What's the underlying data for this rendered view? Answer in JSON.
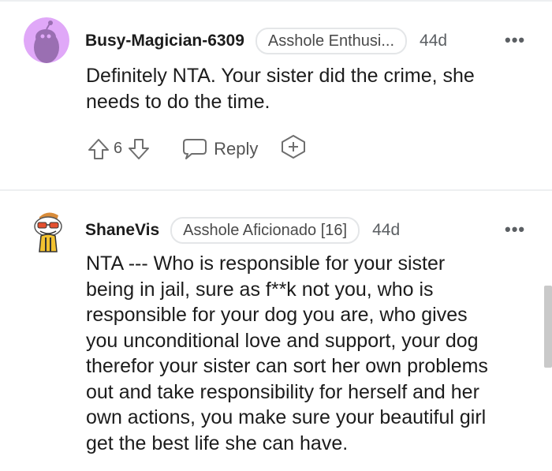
{
  "comments": [
    {
      "username": "Busy-Magician-6309",
      "flair": "Asshole Enthusi...",
      "time": "44d",
      "more": "•••",
      "lines": [
        "Definitely NTA. Your sister did the crime, she",
        "needs to do the time."
      ],
      "votes": "6",
      "reply_label": "Reply",
      "avatar_color": "#e0a8f8"
    },
    {
      "username": "ShaneVis",
      "flair": "Asshole Aficionado [16]",
      "time": "44d",
      "more": "•••",
      "lines": [
        "NTA --- Who is responsible for your sister",
        "being in jail, sure as f**k not you, who is",
        "responsible for your dog you are, who gives",
        "you unconditional love and support, your dog",
        "therefor your sister can sort her own problems",
        "out and take responsibility for herself and her",
        "own actions, you make sure your beautiful girl",
        "get the best life she can have."
      ]
    }
  ]
}
